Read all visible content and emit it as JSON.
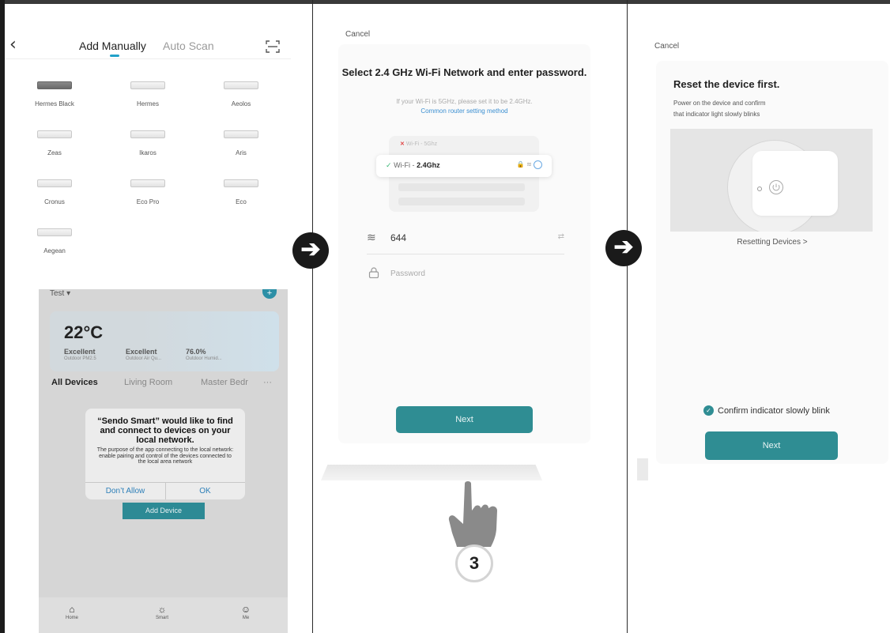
{
  "panel1": {
    "back_icon": "chevron-left-icon",
    "tab_manual": "Add Manually",
    "tab_scan": "Auto Scan",
    "scan_icon": "scan-frame-icon",
    "devices": [
      "Hermes Black",
      "Hermes",
      "Aeolos",
      "Zeas",
      "Ikaros",
      "Aris",
      "Cronus",
      "Eco Pro",
      "Eco",
      "Aegean"
    ]
  },
  "home": {
    "title": "Test ▾",
    "add_icon": "+",
    "temperature": "22°C",
    "metrics": [
      {
        "value": "Excellent",
        "label": "Outdoor PM2.5"
      },
      {
        "value": "Excellent",
        "label": "Outdoor Air Qu..."
      },
      {
        "value": "76.0%",
        "label": "Outdoor Humid..."
      }
    ],
    "rooms": [
      "All Devices",
      "Living Room",
      "Master Bedr",
      "···"
    ],
    "dialog": {
      "title": "“Sendo Smart” would like to find and connect to devices on your local network.",
      "body": "The purpose of the app connecting to the local network: enable pairing and control of the devices connected to the local area network",
      "deny": "Don’t Allow",
      "ok": "OK"
    },
    "add_device": "Add Device",
    "tabs": [
      {
        "icon": "home-icon",
        "glyph": "⌂",
        "label": "Home"
      },
      {
        "icon": "smart-icon",
        "glyph": "☼",
        "label": "Smart"
      },
      {
        "icon": "me-icon",
        "glyph": "☺",
        "label": "Me"
      }
    ]
  },
  "arrow_glyph": "➔",
  "panel2": {
    "cancel": "Cancel",
    "title": "Select 2.4 GHz Wi-Fi Network and enter password.",
    "subtitle": "If your Wi-Fi is 5GHz, please set it to be 2.4GHz.",
    "link": "Common router setting method",
    "wifi_5g": "Wi-Fi - 5Ghz",
    "wifi_24_prefix": "Wi-Fi - ",
    "wifi_24": "2.4Ghz",
    "ssid": "644",
    "password_placeholder": "Password",
    "next": "Next",
    "step_number": "3"
  },
  "panel3": {
    "cancel": "Cancel",
    "title": "Reset the device first.",
    "desc_line1": "Power on the device and confirm",
    "desc_line2": "that indicator light slowly blinks",
    "reset_link": "Resetting Devices >",
    "confirm": "Confirm indicator slowly blink",
    "next": "Next"
  },
  "colors": {
    "accent": "#2f8d93",
    "link": "#3b8fd1",
    "tab_underline": "#21a1c9"
  }
}
